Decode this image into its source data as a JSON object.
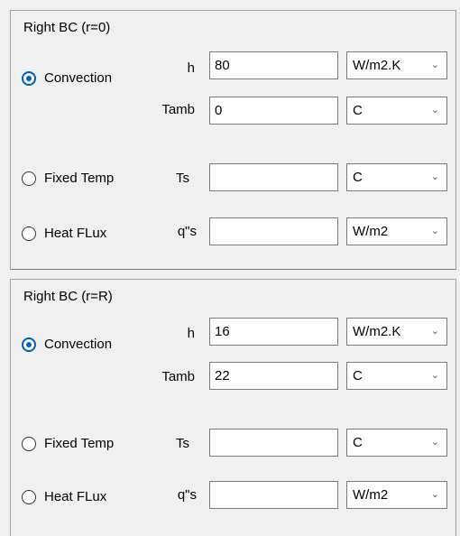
{
  "left_bc": {
    "title": "Right BC (r=0)",
    "convection": {
      "label": "Convection",
      "checked": true
    },
    "fixed_temp": {
      "label": "Fixed Temp",
      "checked": false
    },
    "heat_flux": {
      "label": "Heat FLux",
      "checked": false
    },
    "h": {
      "label": "h",
      "value": "80",
      "unit": "W/m2.K"
    },
    "tamb": {
      "label": "Tamb",
      "value": "0",
      "unit": "C"
    },
    "ts": {
      "label": "Ts",
      "value": "",
      "unit": "C"
    },
    "qs": {
      "label": "q\"s",
      "value": "",
      "unit": "W/m2"
    }
  },
  "right_bc": {
    "title": "Right BC (r=R)",
    "convection": {
      "label": "Convection",
      "checked": true
    },
    "fixed_temp": {
      "label": "Fixed Temp",
      "checked": false
    },
    "heat_flux": {
      "label": "Heat FLux",
      "checked": false
    },
    "h": {
      "label": "h",
      "value": "16",
      "unit": "W/m2.K"
    },
    "tamb": {
      "label": "Tamb",
      "value": "22",
      "unit": "C"
    },
    "ts": {
      "label": "Ts",
      "value": "",
      "unit": "C"
    },
    "qs": {
      "label": "q\"s",
      "value": "",
      "unit": "W/m2"
    }
  },
  "icons": {
    "dropdown": "chevron-down-icon"
  },
  "colors": {
    "accent": "#005fb8",
    "background": "#f0f0f0",
    "border": "#7a7a7a"
  }
}
